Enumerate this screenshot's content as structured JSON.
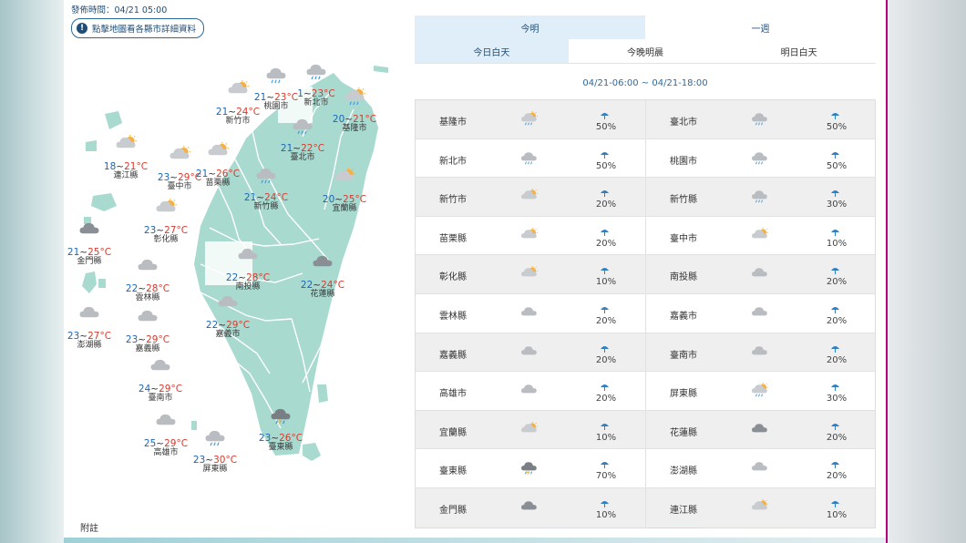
{
  "header": {
    "issue_time": "發佈時間：04/21 05:00",
    "map_button": "點擊地圖看各縣市詳細資料",
    "note": "附註"
  },
  "tabs_top": [
    {
      "label": "今明",
      "active": true
    },
    {
      "label": "一週",
      "active": false
    }
  ],
  "tabs_sub": [
    {
      "label": "今日白天",
      "active": true
    },
    {
      "label": "今晚明晨",
      "active": false
    },
    {
      "label": "明日白天",
      "active": false
    }
  ],
  "time_range": "04/21-06:00 ~ 04/21-18:00",
  "map_labels": [
    {
      "city": "桃園市",
      "lo": "21",
      "hi": "23",
      "icon": "cloudy-rain-icon"
    },
    {
      "city": "新北市",
      "lo": "1",
      "hi": "23",
      "icon": "cloudy-rain-icon"
    },
    {
      "city": "基隆市",
      "lo": "20",
      "hi": "21",
      "icon": "partly-cloudy-rain-icon"
    },
    {
      "city": "新竹市",
      "lo": "21",
      "hi": "24",
      "icon": "partly-cloudy-icon"
    },
    {
      "city": "臺北市",
      "lo": "21",
      "hi": "22",
      "icon": "cloudy-rain-icon"
    },
    {
      "city": "連江縣",
      "lo": "18",
      "hi": "21",
      "icon": "partly-cloudy-icon"
    },
    {
      "city": "臺中市",
      "lo": "23",
      "hi": "29",
      "icon": "partly-cloudy-icon"
    },
    {
      "city": "苗栗縣",
      "lo": "21",
      "hi": "26",
      "icon": "partly-cloudy-icon"
    },
    {
      "city": "新竹縣",
      "lo": "21",
      "hi": "24",
      "icon": "cloudy-rain-icon"
    },
    {
      "city": "宜蘭縣",
      "lo": "20",
      "hi": "25",
      "icon": "partly-cloudy-icon"
    },
    {
      "city": "彰化縣",
      "lo": "23",
      "hi": "27",
      "icon": "partly-cloudy-icon"
    },
    {
      "city": "金門縣",
      "lo": "21",
      "hi": "25",
      "icon": "dark-cloud-icon"
    },
    {
      "city": "雲林縣",
      "lo": "22",
      "hi": "28",
      "icon": "cloudy-icon"
    },
    {
      "city": "南投縣",
      "lo": "22",
      "hi": "28",
      "icon": "cloudy-icon"
    },
    {
      "city": "花蓮縣",
      "lo": "22",
      "hi": "24",
      "icon": "dark-cloud-icon"
    },
    {
      "city": "澎湖縣",
      "lo": "23",
      "hi": "27",
      "icon": "cloudy-icon"
    },
    {
      "city": "嘉義縣",
      "lo": "23",
      "hi": "29",
      "icon": "cloudy-icon"
    },
    {
      "city": "嘉義市",
      "lo": "22",
      "hi": "29",
      "icon": "cloudy-icon"
    },
    {
      "city": "臺南市",
      "lo": "24",
      "hi": "29",
      "icon": "cloudy-icon"
    },
    {
      "city": "高雄市",
      "lo": "25",
      "hi": "29",
      "icon": "cloudy-icon"
    },
    {
      "city": "屏東縣",
      "lo": "23",
      "hi": "30",
      "icon": "cloudy-rain-icon"
    },
    {
      "city": "臺東縣",
      "lo": "23",
      "hi": "26",
      "icon": "storm-rain-icon"
    }
  ],
  "temp_unit": "°C",
  "table_rows": [
    [
      {
        "city": "基隆市",
        "icon": "partly-cloudy-rain-icon",
        "pop": "50%"
      },
      {
        "city": "臺北市",
        "icon": "cloudy-rain-icon",
        "pop": "50%"
      }
    ],
    [
      {
        "city": "新北市",
        "icon": "cloudy-rain-icon",
        "pop": "50%"
      },
      {
        "city": "桃園市",
        "icon": "cloudy-rain-icon",
        "pop": "50%"
      }
    ],
    [
      {
        "city": "新竹市",
        "icon": "partly-cloudy-icon",
        "pop": "20%"
      },
      {
        "city": "新竹縣",
        "icon": "cloudy-rain-icon",
        "pop": "30%"
      }
    ],
    [
      {
        "city": "苗栗縣",
        "icon": "partly-cloudy-icon",
        "pop": "20%"
      },
      {
        "city": "臺中市",
        "icon": "partly-cloudy-icon",
        "pop": "10%"
      }
    ],
    [
      {
        "city": "彰化縣",
        "icon": "partly-cloudy-icon",
        "pop": "10%"
      },
      {
        "city": "南投縣",
        "icon": "cloudy-icon",
        "pop": "20%"
      }
    ],
    [
      {
        "city": "雲林縣",
        "icon": "cloudy-icon",
        "pop": "20%"
      },
      {
        "city": "嘉義市",
        "icon": "cloudy-icon",
        "pop": "20%"
      }
    ],
    [
      {
        "city": "嘉義縣",
        "icon": "cloudy-icon",
        "pop": "20%"
      },
      {
        "city": "臺南市",
        "icon": "cloudy-icon",
        "pop": "20%"
      }
    ],
    [
      {
        "city": "高雄市",
        "icon": "cloudy-icon",
        "pop": "20%"
      },
      {
        "city": "屏東縣",
        "icon": "partly-cloudy-rain-icon",
        "pop": "30%"
      }
    ],
    [
      {
        "city": "宜蘭縣",
        "icon": "partly-cloudy-icon",
        "pop": "10%"
      },
      {
        "city": "花蓮縣",
        "icon": "dark-cloud-icon",
        "pop": "20%"
      }
    ],
    [
      {
        "city": "臺東縣",
        "icon": "storm-rain-icon",
        "pop": "70%"
      },
      {
        "city": "澎湖縣",
        "icon": "cloudy-icon",
        "pop": "20%"
      }
    ],
    [
      {
        "city": "金門縣",
        "icon": "dark-cloud-icon",
        "pop": "10%"
      },
      {
        "city": "連江縣",
        "icon": "partly-cloudy-icon",
        "pop": "10%"
      }
    ]
  ],
  "colors": {
    "map_fill": "#a8dad0",
    "accent": "#1f4e79",
    "low_temp": "#1a66b8",
    "high_temp": "#d9382c",
    "tab_active": "#dfeef9"
  }
}
